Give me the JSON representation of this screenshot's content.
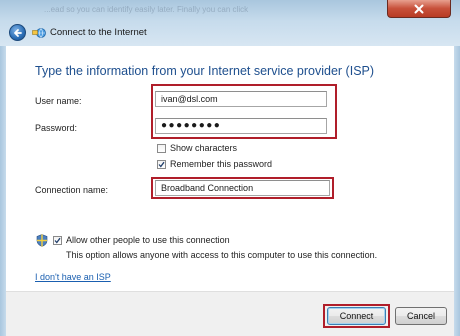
{
  "window": {
    "title": "Connect to the Internet",
    "ghost_text": "...ead so you can identify easily later. Finally you can click"
  },
  "heading": "Type the information from your Internet service provider (ISP)",
  "fields": {
    "username_label": "User name:",
    "username_value": "ivan@dsl.com",
    "password_label": "Password:",
    "password_value": "●●●●●●●●",
    "connection_label": "Connection name:",
    "connection_value": "Broadband Connection"
  },
  "options": {
    "show_characters": {
      "label": "Show characters",
      "checked": false
    },
    "remember_password": {
      "label": "Remember this password",
      "checked": true
    },
    "allow_others": {
      "label": "Allow other people to use this connection",
      "checked": true
    },
    "allow_others_desc": "This option allows anyone with access to this computer to use this connection."
  },
  "link_no_isp": "I don't have an ISP",
  "buttons": {
    "connect": "Connect",
    "cancel": "Cancel"
  },
  "colors": {
    "heading": "#1e4f8e",
    "highlight_border": "#b01e2a",
    "link": "#1a5fb0"
  },
  "icons": [
    "back-arrow-icon",
    "network-globe-icon",
    "close-icon",
    "shield-icon",
    "checkmark-icon"
  ]
}
